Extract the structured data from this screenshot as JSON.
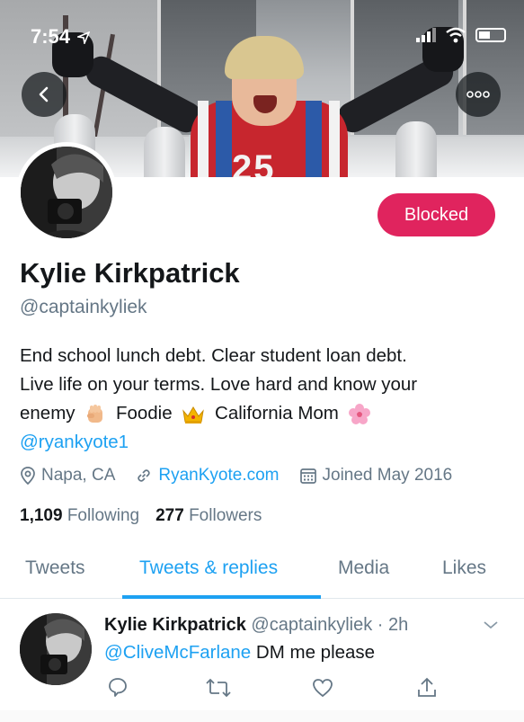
{
  "status_bar": {
    "time": "7:54"
  },
  "profile": {
    "name": "Kylie Kirkpatrick",
    "handle": "@captainkyliek",
    "blocked_label": "Blocked",
    "bio_line1": "End school lunch debt. Clear student loan debt.",
    "bio_line2": "Live life on your terms. Love hard and know your",
    "bio_line3_a": "enemy",
    "bio_line3_b": "Foodie",
    "bio_line3_c": "California Mom",
    "bio_mention": "@ryankyote1",
    "location": "Napa, CA",
    "website": "RyanKyote.com",
    "joined": "Joined May 2016",
    "following_count": "1,109",
    "following_label": "Following",
    "followers_count": "277",
    "followers_label": "Followers"
  },
  "tabs": [
    {
      "label": "Tweets"
    },
    {
      "label": "Tweets & replies"
    },
    {
      "label": "Media"
    },
    {
      "label": "Likes"
    }
  ],
  "tweet": {
    "author": "Kylie Kirkpatrick",
    "handle_time": "@captainkyliek · 2h",
    "mention": "@CliveMcFarlane",
    "text": "DM me please"
  },
  "colors": {
    "accent": "#1da1f2",
    "blocked": "#e0245e",
    "muted": "#657786"
  },
  "icons": [
    "back-arrow-icon",
    "more-icon",
    "location-pin-icon",
    "link-icon",
    "calendar-icon",
    "reply-icon",
    "retweet-icon",
    "like-icon",
    "share-icon",
    "chevron-down-icon"
  ]
}
